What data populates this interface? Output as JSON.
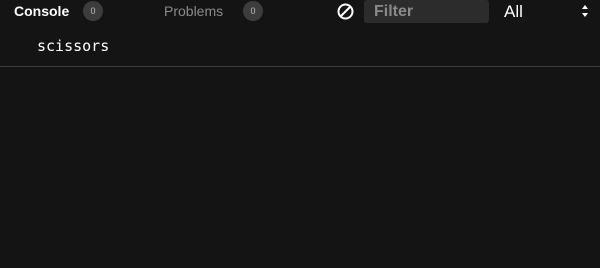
{
  "toolbar": {
    "tabs": [
      {
        "label": "Console",
        "count": "0"
      },
      {
        "label": "Problems",
        "count": "0"
      }
    ],
    "clear_icon": "clear-console-icon",
    "filter": {
      "placeholder": "Filter",
      "value": ""
    },
    "level": {
      "selected": "All"
    }
  },
  "log": {
    "entries": [
      {
        "text": "scissors"
      }
    ]
  },
  "colors": {
    "background": "#141414",
    "badge": "#3d3d3d",
    "filter_bg": "#2c2c2c",
    "divider": "#3a3a3a",
    "inactive_text": "#8a8a8a"
  }
}
